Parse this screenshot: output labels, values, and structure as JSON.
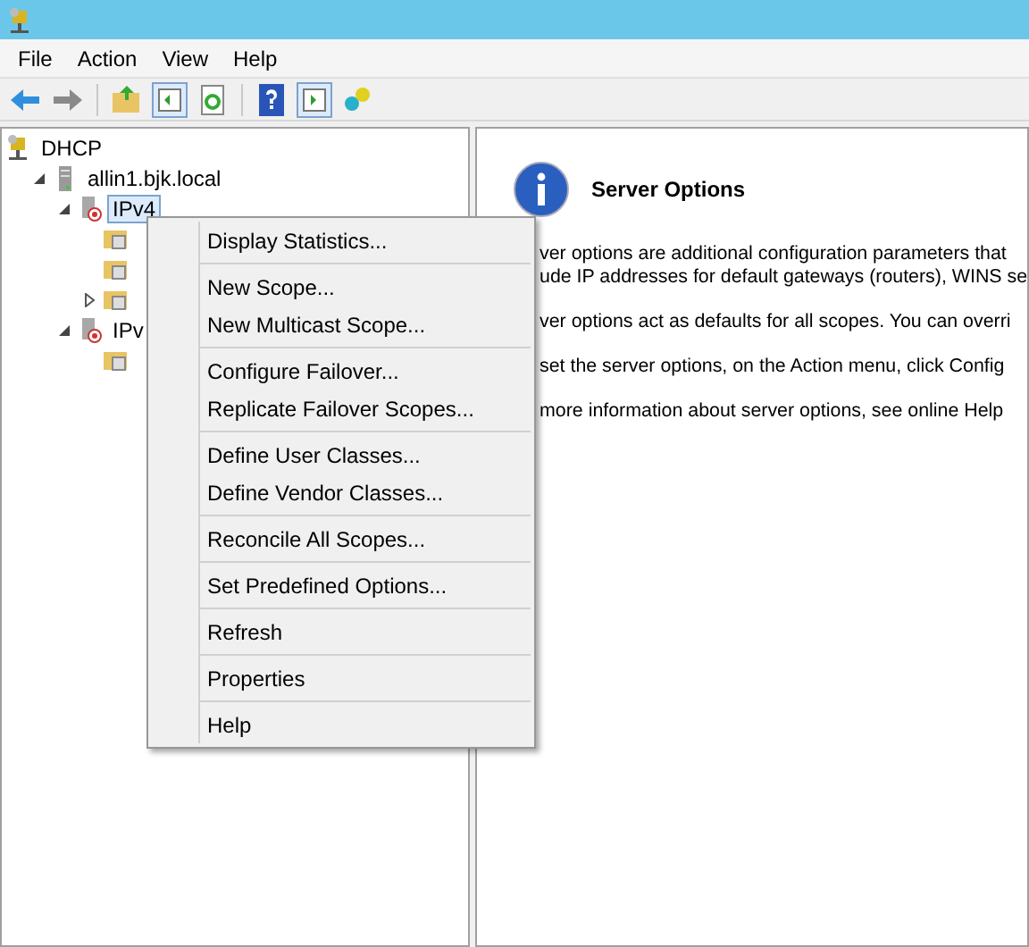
{
  "menu_bar": [
    "File",
    "Action",
    "View",
    "Help"
  ],
  "tree": [
    {
      "label": "DHCP",
      "kind": "root",
      "selected": false,
      "children": [
        {
          "label": "allin1.bjk.local",
          "kind": "server",
          "expanded": true,
          "selected": false,
          "children": [
            {
              "label": "IPv4",
              "kind": "protocol",
              "expanded": true,
              "selected": true,
              "children": [
                {
                  "kind": "folder",
                  "selected": false
                },
                {
                  "kind": "folder",
                  "selected": false
                },
                {
                  "kind": "folder",
                  "expanded": false,
                  "selected": false
                }
              ]
            },
            {
              "label": "IPv",
              "kind": "protocol",
              "expanded": true,
              "selected": false,
              "children": [
                {
                  "kind": "folder",
                  "selected": false
                }
              ]
            }
          ]
        }
      ]
    }
  ],
  "details": {
    "title": "Server Options",
    "paragraphs": [
      [
        "ver options are additional configuration parameters that",
        "ude IP addresses for default gateways (routers), WINS se"
      ],
      [
        "ver options act as defaults for all scopes.  You can overri"
      ],
      [
        "set the server options, on the Action menu, click Config"
      ],
      [
        "more information about server options, see online Help"
      ]
    ]
  },
  "context_menu": [
    [
      "Display Statistics..."
    ],
    [
      "New Scope...",
      "New Multicast Scope..."
    ],
    [
      "Configure Failover...",
      "Replicate Failover Scopes..."
    ],
    [
      "Define User Classes...",
      "Define Vendor Classes..."
    ],
    [
      "Reconcile All Scopes..."
    ],
    [
      "Set Predefined Options..."
    ],
    [
      "Refresh"
    ],
    [
      "Properties"
    ],
    [
      "Help"
    ]
  ]
}
